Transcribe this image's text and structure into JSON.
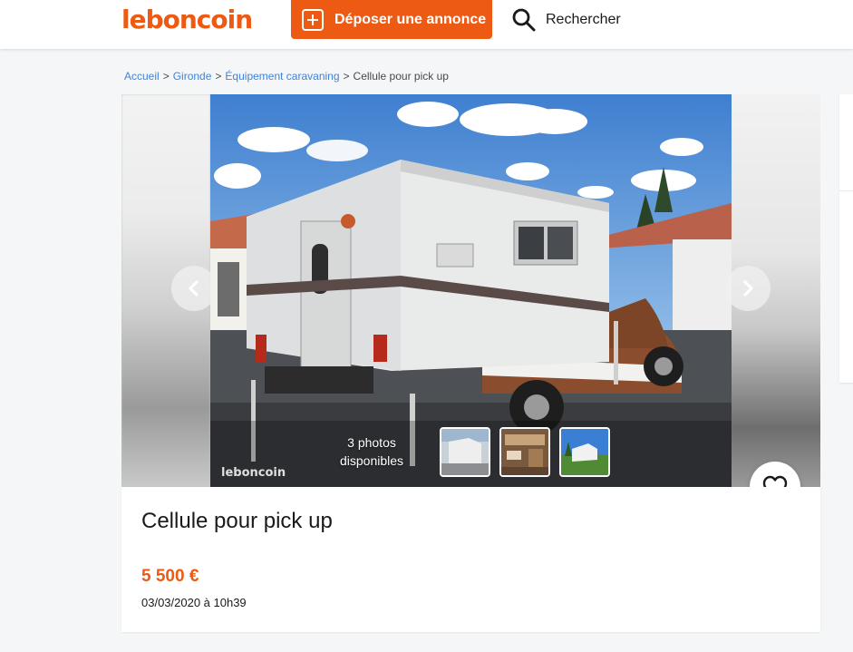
{
  "header": {
    "logo": "leboncoin",
    "post_label": "Déposer une annonce",
    "search_label": "Rechercher"
  },
  "breadcrumb": [
    {
      "label": "Accueil"
    },
    {
      "label": "Gironde"
    },
    {
      "label": "Équipement caravaning"
    },
    {
      "label": "Cellule pour pick up"
    }
  ],
  "gallery": {
    "watermark": "leboncoin",
    "photo_count_line1": "3 photos",
    "photo_count_line2": "disponibles",
    "prev_icon": "chevron-left-icon",
    "next_icon": "chevron-right-icon"
  },
  "ad": {
    "title": "Cellule pour pick up",
    "price": "5 500 €",
    "date": "03/03/2020 à 10h39"
  },
  "colors": {
    "brand": "#ec5a13",
    "link": "#4183d7",
    "background": "#f4f6f7"
  }
}
